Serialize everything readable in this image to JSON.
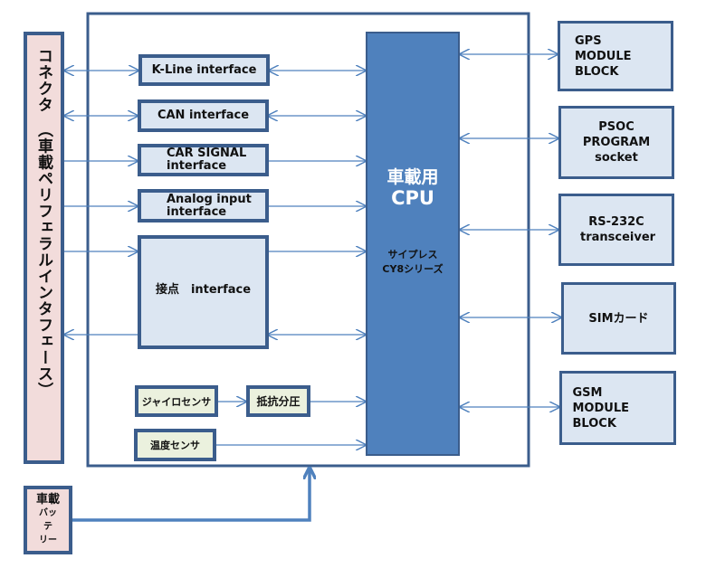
{
  "colors": {
    "outline": "#3b5d8c",
    "cpu": "#4f81bd",
    "interface_fill": "#dce6f2",
    "sensor_fill": "#ebf1de",
    "connector_fill": "#f2dcdb",
    "arrow": "#4f81bd"
  },
  "connector": {
    "label": "コネクタ　（車載ペリフェラルインタフェース）"
  },
  "interfaces": [
    {
      "label": "K-Line interface"
    },
    {
      "label": "CAN interface"
    },
    {
      "label": "CAR SIGNAL interface"
    },
    {
      "label": "Analog input interface"
    },
    {
      "label": "接点　interface"
    }
  ],
  "sensors": {
    "gyro": "ジャイロセンサ",
    "divider": "抵抗分圧",
    "temperature": "温度センサ"
  },
  "cpu": {
    "title_line1": "車載用",
    "title_line2": "CPU",
    "sub_line1": "サイプレス",
    "sub_line2": "CY8シリーズ"
  },
  "modules": [
    {
      "label": "GPS MODULE BLOCK"
    },
    {
      "label": "PSOC PROGRAM socket"
    },
    {
      "label": "RS-232C transceiver"
    },
    {
      "label": "SIMカード"
    },
    {
      "label": "GSM　MODULE BLOCK"
    }
  ],
  "battery": {
    "line1": "車載",
    "line2": "バッ",
    "line3": "テ",
    "line4": "リー"
  }
}
